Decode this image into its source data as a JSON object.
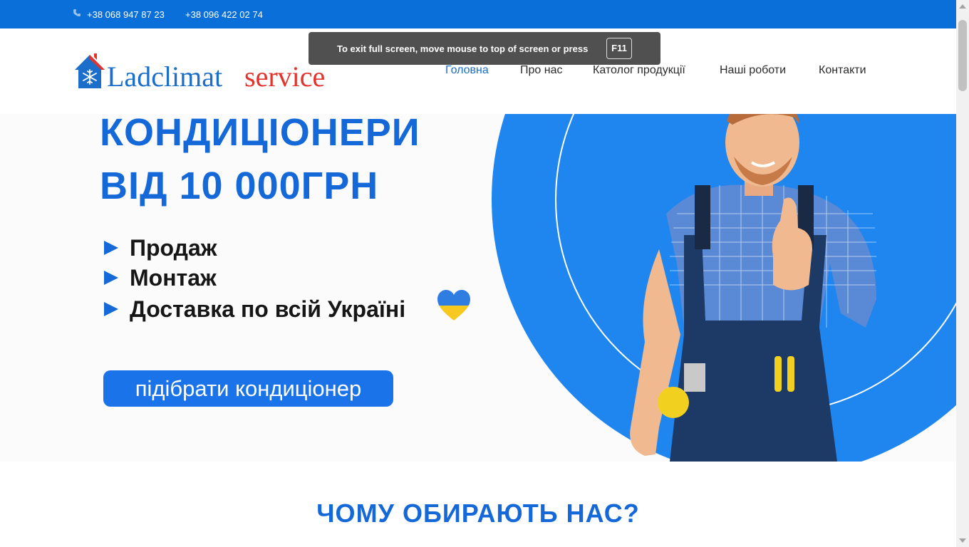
{
  "topbar": {
    "phone1": "+38 068 947 87 23",
    "phone2": "+38 096 422 02 74",
    "icon": "phone-icon"
  },
  "header": {
    "logo_word1": "Ladclimat",
    "logo_word2": "service",
    "nav": [
      "Головна",
      "Про нас",
      "Католог продукції",
      "Наші роботи",
      "Контакти"
    ],
    "active_nav": "Головна"
  },
  "toast": {
    "text": "To exit full screen, move mouse to top of screen or press",
    "key": "F11"
  },
  "hero": {
    "title_line1": "КОНДИЦІОНЕРИ",
    "title_line2": "ВІД 10 000ГРН",
    "bullets": [
      "Продаж",
      "Монтаж",
      "Доставка по всій Україні"
    ],
    "cta": "підібрати кондиціонер"
  },
  "section": {
    "title": "ЧОМУ ОБИРАЮТЬ НАС?"
  },
  "colors": {
    "brand_blue": "#1468d8",
    "topbar_blue": "#0b6fd9",
    "logo_red": "#e4332c",
    "cta_blue": "#1a73e8"
  }
}
